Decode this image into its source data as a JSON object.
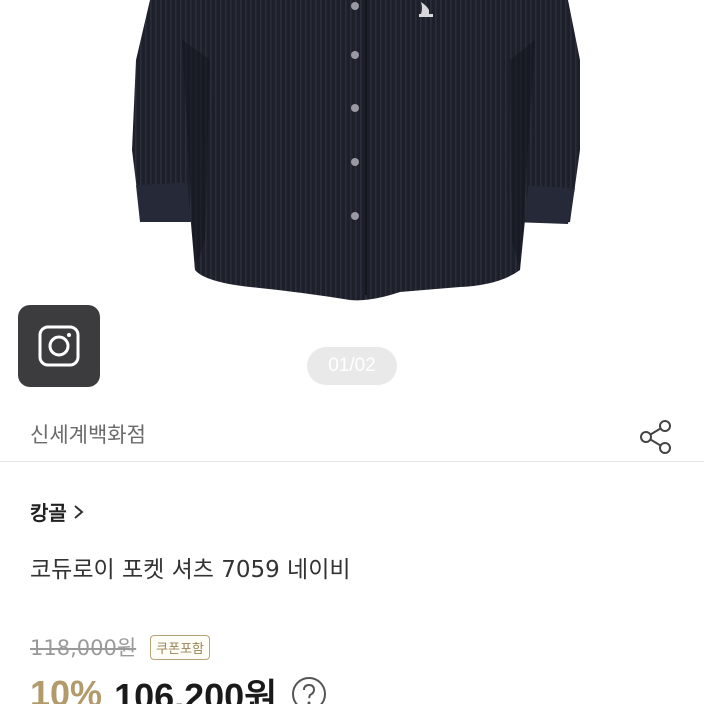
{
  "gallery": {
    "pager_text": "01/02"
  },
  "store": {
    "name": "신세계백화점"
  },
  "product": {
    "brand": "캉골",
    "name": "코듀로이 포켓 셔츠 7059 네이비"
  },
  "price": {
    "original": "118,000원",
    "coupon_badge": "쿠폰포함",
    "discount_rate": "10%",
    "final": "106,200원"
  },
  "colors": {
    "accent_gold": "#b39a6a",
    "shirt_navy": "#1d1f29"
  },
  "icons": [
    "camera-icon",
    "share-icon",
    "chevron-right-icon",
    "help-icon"
  ]
}
